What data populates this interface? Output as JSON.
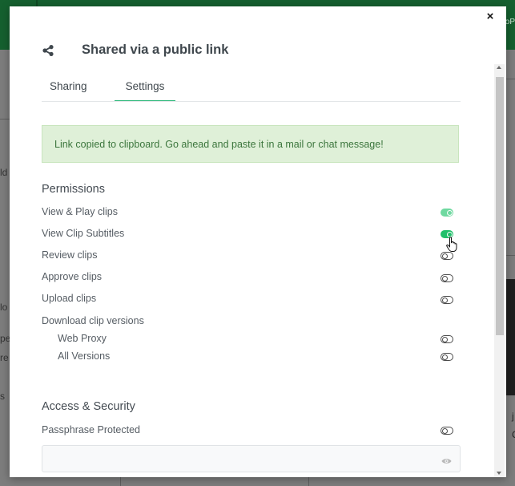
{
  "background": {
    "left_edge_texts": [
      "ld",
      "lo",
      "pe",
      "re",
      "s"
    ],
    "right_edge_text": "oP",
    "right_edge_chars": [
      "j",
      "C"
    ]
  },
  "modal": {
    "close_label": "×",
    "title": "Shared via a public link",
    "tabs": [
      {
        "label": "Sharing",
        "active": false
      },
      {
        "label": "Settings",
        "active": true
      }
    ],
    "alert": "Link copied to clipboard. Go ahead and paste it in a mail or chat message!",
    "permissions": {
      "title": "Permissions",
      "items": [
        {
          "label": "View & Play clips",
          "enabled": true
        },
        {
          "label": "View Clip Subtitles",
          "enabled": true
        },
        {
          "label": "Review clips",
          "enabled": false
        },
        {
          "label": "Approve clips",
          "enabled": false
        },
        {
          "label": "Upload clips",
          "enabled": false
        }
      ],
      "download": {
        "label": "Download clip versions",
        "subitems": [
          {
            "label": "Web Proxy",
            "enabled": false
          },
          {
            "label": "All Versions",
            "enabled": false
          }
        ]
      }
    },
    "access": {
      "title": "Access & Security",
      "passphrase": {
        "label": "Passphrase Protected",
        "enabled": false,
        "value": ""
      }
    }
  },
  "colors": {
    "brand_green": "#15602f",
    "toggle_on": "#20c06a",
    "alert_bg": "#dff0d8",
    "alert_text": "#3c763d"
  }
}
